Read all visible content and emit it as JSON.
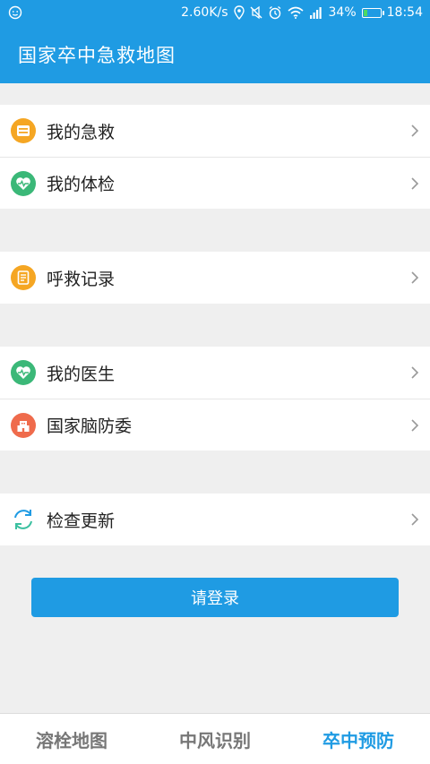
{
  "status_bar": {
    "speed": "2.60K/s",
    "battery_percent": "34%",
    "battery_level": 0.34,
    "time": "18:54",
    "icons": [
      "smiley-icon",
      "location-icon",
      "mute-icon",
      "alarm-icon",
      "wifi-icon",
      "signal-icon",
      "battery-icon"
    ]
  },
  "app_bar": {
    "title": "国家卒中急救地图"
  },
  "menu": {
    "group1": [
      {
        "label": "我的急救",
        "icon": "first-aid-icon",
        "color": "#f5a623"
      },
      {
        "label": "我的体检",
        "icon": "heart-pulse-icon",
        "color": "#3bb878"
      }
    ],
    "group2": [
      {
        "label": "呼救记录",
        "icon": "record-icon",
        "color": "#f5a623"
      }
    ],
    "group3": [
      {
        "label": "我的医生",
        "icon": "heart-pulse-icon",
        "color": "#3bb878"
      },
      {
        "label": "国家脑防委",
        "icon": "building-icon",
        "color": "#ef6b4c"
      }
    ],
    "group4": [
      {
        "label": "检查更新",
        "icon": "refresh-icon",
        "color": "#1f9be3"
      }
    ]
  },
  "login_button": "请登录",
  "tabs": [
    {
      "label": "溶栓地图",
      "active": false
    },
    {
      "label": "中风识别",
      "active": false
    },
    {
      "label": "卒中预防",
      "active": true
    }
  ],
  "colors": {
    "primary": "#1f9be3",
    "background": "#efefef"
  }
}
